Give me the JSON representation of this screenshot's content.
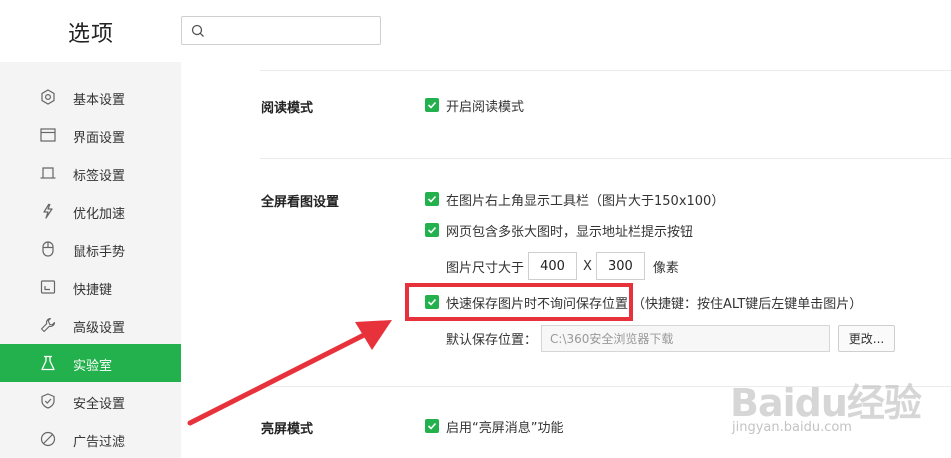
{
  "header": {
    "title": "选项",
    "search_placeholder": ""
  },
  "sidebar": {
    "items": [
      {
        "label": "基本设置",
        "icon": "settings-icon",
        "active": false
      },
      {
        "label": "界面设置",
        "icon": "window-icon",
        "active": false
      },
      {
        "label": "标签设置",
        "icon": "tab-icon",
        "active": false
      },
      {
        "label": "优化加速",
        "icon": "lightning-icon",
        "active": false
      },
      {
        "label": "鼠标手势",
        "icon": "mouse-icon",
        "active": false
      },
      {
        "label": "快捷键",
        "icon": "keyboard-icon",
        "active": false
      },
      {
        "label": "高级设置",
        "icon": "wrench-icon",
        "active": false
      },
      {
        "label": "实验室",
        "icon": "flask-icon",
        "active": true
      },
      {
        "label": "安全设置",
        "icon": "shield-icon",
        "active": false
      },
      {
        "label": "广告过滤",
        "icon": "block-icon",
        "active": false
      }
    ],
    "active_color": "#23b14d"
  },
  "reading": {
    "title": "阅读模式",
    "options": [
      {
        "label": "开启阅读模式",
        "checked": true
      }
    ]
  },
  "fullscreen": {
    "title": "全屏看图设置",
    "options": [
      {
        "label": "在图片右上角显示工具栏（图片大于150x100）",
        "checked": true
      },
      {
        "label": "网页包含多张大图时，显示地址栏提示按钮",
        "checked": true
      }
    ],
    "size": {
      "prefix": "图片尺寸大于",
      "width": "400",
      "separator": "X",
      "height": "300",
      "unit": "像素"
    },
    "quick_save": {
      "label": "快速保存图片时不询问保存位置",
      "hint": "（快捷键：按住ALT键后左键单击图片）",
      "checked": true
    },
    "default_path": {
      "label": "默认保存位置：",
      "value": "C:\\360安全浏览器下载",
      "button": "更改..."
    }
  },
  "bright": {
    "title": "亮屏模式",
    "options": [
      {
        "label": "启用“亮屏消息”功能",
        "checked": true
      }
    ]
  },
  "annotation": {
    "highlight_color": "#e8323b"
  },
  "watermark": {
    "logo": "Baidu经验",
    "url": "jingyan.baidu.com"
  }
}
